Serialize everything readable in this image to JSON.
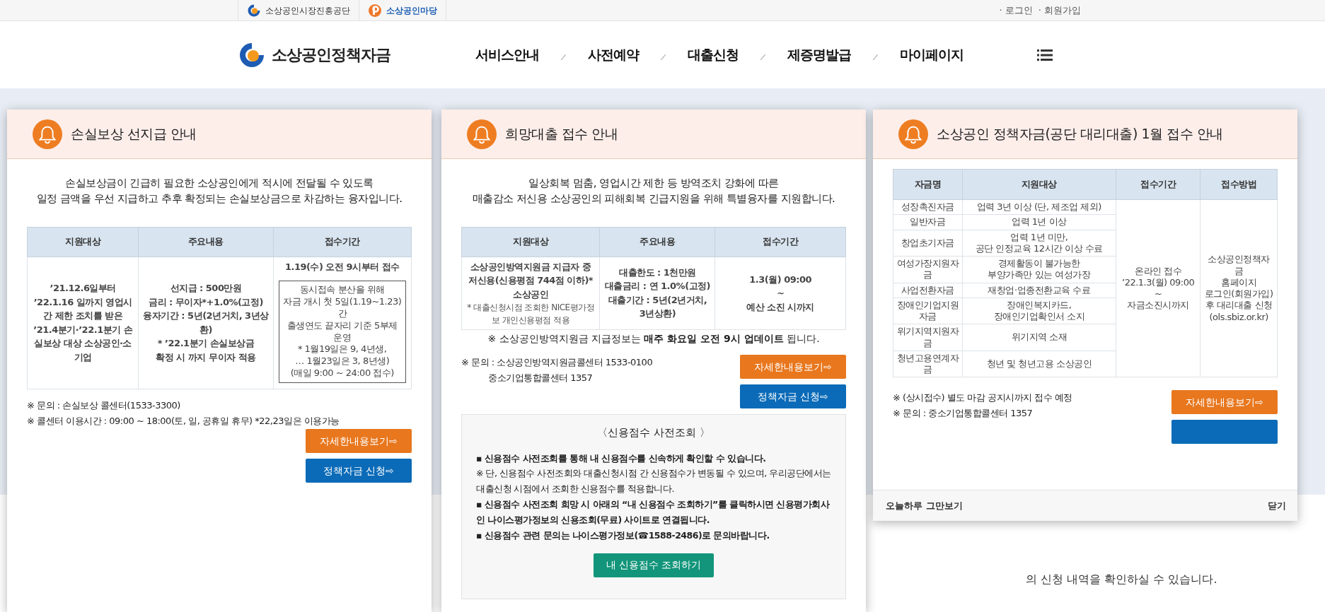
{
  "top_bar": {
    "links": [
      {
        "label": "소상공인시장진흥공단"
      },
      {
        "label": "소상공인마당"
      }
    ],
    "account_links": [
      "· 로그인",
      "· 회원가입"
    ]
  },
  "header": {
    "logo": "소상공인정책자금",
    "nav": [
      "서비스안내",
      "사전예약",
      "대출신청",
      "제증명발급",
      "마이페이지"
    ]
  },
  "page_text": "의 신청 내역을 확인하실 수 있습니다.",
  "popups": [
    {
      "title": "손실보상 선지급 안내",
      "intro": "손실보상금이 긴급히 필요한 소상공인에게 적시에 전달될 수 있도록\n일정 금액을 우선 지급하고 추후 확정되는 손실보상금으로 차감하는 융자입니다.",
      "table": {
        "columns": [
          "지원대상",
          "주요내용",
          "접수기간"
        ],
        "rows": [
          [
            {
              "text": "’21.12.6일부터 ’22.1.16 일까지 영업시간 제한 조치를 받은 ’21.4분기·’22.1분기 손실보상 대상 소상공인·소기업"
            },
            {
              "text": "선지급 : 500만원\n금리 : 무이자*+1.0%(고정)\n융자기간 : 5년(2년거치, 3년상환)\n* ’22.1분기 손실보상금\n확정 시 까지 무이자 적용"
            },
            {
              "text": "1.19(수) 오전 9시부터 접수",
              "boxed_note": "동시접속 분산을 위해\n자금 개시 첫 5일(1.19~1.23)간\n출생연도 끝자리 기준 5부제 운영\n* 1월19일은 9, 4년생,\n… 1월23일은 3, 8년생)\n(매일 9:00 ~ 24:00 접수)"
            }
          ]
        ]
      },
      "notes": [
        {
          "text": "※ 문의 : 손실보상 콜센터(1533-3300)",
          "indent": false
        },
        {
          "text": "※ 콜센터 이용시간 : 09:00 ~ 18:00(토, 일, 공휴일 휴무) *22,23일은 이용가능",
          "indent": false
        }
      ],
      "buttons": [
        {
          "kind": "detail",
          "label": "자세한내용보기⇨"
        },
        {
          "kind": "apply",
          "label": "정책자금 신청⇨"
        }
      ]
    },
    {
      "title": "희망대출 접수 안내",
      "intro": "일상회복 멈춤, 영업시간 제한 등 방역조치 강화에 따른\n매출감소 저신용 소상공인의 피해회복 긴급지원을 위해 특별융자를 지원합니다.",
      "table": {
        "columns": [
          "지원대상",
          "주요내용",
          "접수기간"
        ],
        "rows": [
          [
            {
              "text": "소상공인방역지원금 지급자 중 저신용(신용평점 744점 이하)* 소상공인",
              "small_note": "* 대출신청시점 조회한 NICE평가정보 개인신용평점 적용"
            },
            {
              "text": "대출한도 : 1천만원\n대출금리 : 연 1.0%(고정)\n대출기간 : 5년(2년거치, 3년상환)"
            },
            {
              "text": "1.3(월) 09:00\n~\n예산 소진 시까지"
            }
          ]
        ]
      },
      "highlight": "※ 소상공인방역지원금 지급정보는 **매주 화요일 오전 9시 업데이트** 됩니다.",
      "notes": [
        {
          "text": "※ 문의 : 소상공인방역지원금콜센터 1533-0100",
          "indent": false
        },
        {
          "text": "중소기업통합콜센터 1357",
          "indent": true
        }
      ],
      "buttons": [
        {
          "kind": "detail",
          "label": "자세한내용보기⇨"
        },
        {
          "kind": "apply",
          "label": "정책자금 신청⇨"
        }
      ],
      "credit_box": {
        "title": "〈신용점수 사전조회 〉",
        "paragraphs": [
          {
            "text": "▪ 신용점수 사전조회를 통해 내 신용점수를 신속하게 확인할 수 있습니다.",
            "bold": true
          },
          {
            "text": "※ 단, 신용점수 사전조회와 대출신청시점 간 신용점수가 변동될 수 있으며, 우리공단에서는 대출신청 시점에서 조회한 신용점수를 적용합니다.",
            "bold": false
          },
          {
            "text": "▪ 신용점수 사전조회 희망 시 아래의 “내 신용점수 조회하기”를 클릭하시면 신용평가회사인 나이스평가정보의 신용조회(무료) 사이트로 연결됩니다.",
            "bold": true
          },
          {
            "text": "▪ 신용점수 관련 문의는 나이스평가정보(☎1588-2486)로 문의바랍니다.",
            "bold": true
          }
        ],
        "button": "내 신용점수 조회하기"
      }
    },
    {
      "title": "소상공인 정책자금(공단 대리대출) 1월 접수 안내",
      "table": {
        "columns": [
          "자금명",
          "지원대상",
          "접수기간",
          "접수방법"
        ],
        "rows": [
          [
            {
              "text": "성장촉진자금"
            },
            {
              "text": "업력 3년 이상 (단, 제조업 제외)"
            }
          ],
          [
            {
              "text": "일반자금"
            },
            {
              "text": "업력 1년 이상"
            }
          ],
          [
            {
              "text": "창업초기자금"
            },
            {
              "text": "업력 1년 미만,\n공단 인정교육 12시간 이상 수료"
            }
          ],
          [
            {
              "text": "여성가장지원자금"
            },
            {
              "text": "경제활동이 불가능한\n부양가족만 있는 여성가장"
            }
          ],
          [
            {
              "text": "사업전환자금"
            },
            {
              "text": "재창업·업종전환교육 수료"
            }
          ],
          [
            {
              "text": "장애인기업지원자금"
            },
            {
              "text": "장애인복지카드,\n장애인기업확인서 소지"
            }
          ],
          [
            {
              "text": "위기지역지원자금"
            },
            {
              "text": "위기지역 소재"
            }
          ],
          [
            {
              "text": "청년고용연계자금"
            },
            {
              "text": "청년 및 청년고용 소상공인"
            }
          ]
        ],
        "spanning": [
          {
            "text": "온라인 접수\n’22.1.3(월) 09:00\n~\n자금소진시까지"
          },
          {
            "text": "소상공인정책자금\n홈페이지\n로그인(회원가입)\n후 대리대출 신청\n(ols.sbiz.or.kr)"
          }
        ]
      },
      "notes": [
        {
          "text": "※ (상시접수) 별도 마감 공지시까지 접수 예정",
          "indent": false
        },
        {
          "text": "※ 문의 : 중소기업통합콜센터 1357",
          "indent": false
        }
      ],
      "buttons": [
        {
          "kind": "detail",
          "label": "자세한내용보기⇨"
        },
        {
          "kind": "apply"
        }
      ],
      "footer": {
        "dismiss": "오늘하루 그만보기",
        "close": "닫기"
      }
    }
  ]
}
